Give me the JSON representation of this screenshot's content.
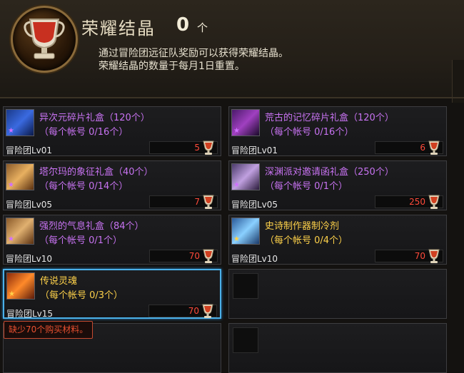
{
  "header": {
    "title": "荣耀结晶",
    "count": "0",
    "unit": "个",
    "desc_line1": "通过冒险团远征队奖励可以获得荣耀结晶。",
    "desc_line2": "荣耀结晶的数量于每月1日重置。",
    "emblem_icon": "trophy-cup-icon"
  },
  "items": [
    {
      "name": "异次元碎片礼盒（120个）",
      "limit": "（每个帐号 0/16个）",
      "req": "冒险团Lv01",
      "price": "5",
      "rarity": "purple"
    },
    {
      "name": "荒古的记忆碎片礼盒（120个）",
      "limit": "（每个帐号 0/16个）",
      "req": "冒险团Lv01",
      "price": "6",
      "rarity": "purple"
    },
    {
      "name": "塔尔玛的象征礼盒（40个）",
      "limit": "（每个帐号 0/14个）",
      "req": "冒险团Lv05",
      "price": "7",
      "rarity": "purple"
    },
    {
      "name": "深渊派对邀请函礼盒（250个）",
      "limit": "（每个帐号 0/1个）",
      "req": "冒险团Lv05",
      "price": "250",
      "rarity": "purple"
    },
    {
      "name": "强烈的气息礼盒（84个）",
      "limit": "（每个帐号 0/1个）",
      "req": "冒险团Lv10",
      "price": "70",
      "rarity": "purple"
    },
    {
      "name": "史诗制作器制冷剂",
      "limit": "（每个帐号 0/4个）",
      "req": "冒险团Lv10",
      "price": "70",
      "rarity": "orange"
    },
    {
      "name": "传说灵魂",
      "limit": "（每个帐号 0/3个）",
      "req": "冒险团Lv15",
      "price": "70",
      "rarity": "orange"
    }
  ],
  "warning": "缺少70个购买材料。"
}
